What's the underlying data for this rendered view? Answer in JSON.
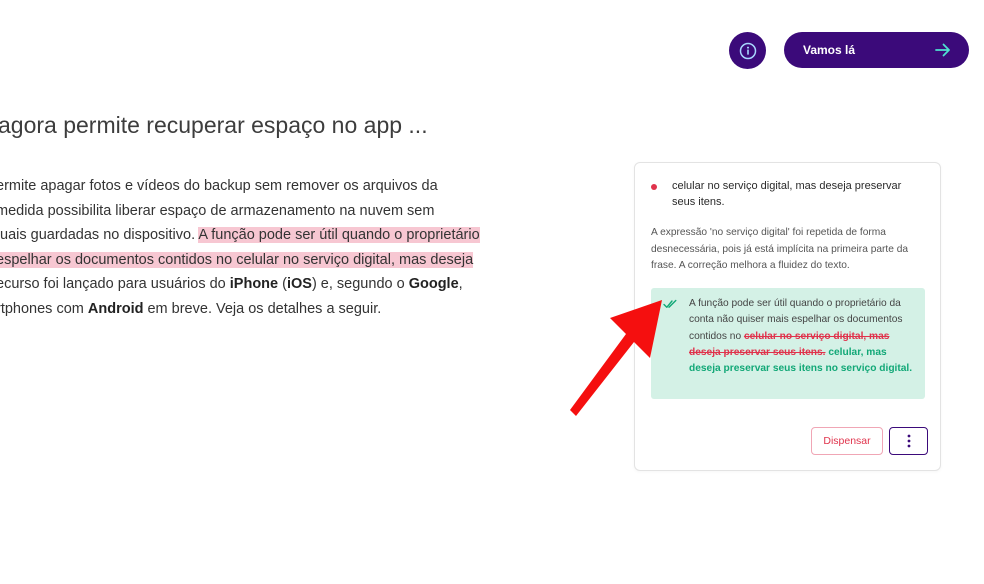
{
  "header": {
    "info_icon": "info-circle-icon",
    "cta_label": "Vamos lá",
    "cta_icon": "arrow-right-icon",
    "accent_color": "#3b0a7a"
  },
  "article": {
    "title": "agora permite recuperar espaço no app ...",
    "lines": {
      "l1": "ermite apagar fotos e vídeos do backup sem remover os arquivos da",
      "l2": "medida possibilita liberar espaço de armazenamento na nuvem sem",
      "l3_pre": "tuais guardadas no dispositivo. ",
      "l3_hl": "A função pode ser útil quando o proprietário",
      "l4_hl": " espelhar os documentos contidos no celular no serviço digital, mas deseja",
      "l5_a": "ecurso foi lançado para usuários do ",
      "l5_iphone": "iPhone",
      "l5_b": " (",
      "l5_ios": "iOS",
      "l5_c": ") e, segundo o ",
      "l5_google": "Google",
      "l5_d": ",",
      "l6_a": "rtphones com ",
      "l6_android": "Android",
      "l6_b": " em breve. Veja os detalhes a seguir."
    },
    "highlight_color": "#f7c7d2"
  },
  "card": {
    "issue_title": "celular no serviço digital, mas deseja preservar seus itens.",
    "explanation": "A expressão 'no serviço digital' foi repetida de forma desnecessária, pois já está implícita na primeira parte da frase. A correção melhora a fluidez do texto.",
    "suggestion": {
      "prefix": "A função pode ser útil quando o proprietário da conta não quiser mais espelhar os documentos contidos no ",
      "deleted": "celular no serviço digital, mas deseja preservar seus itens.",
      "inserted": "celular, mas deseja preservar seus itens no serviço digital."
    },
    "dismiss_label": "Dispensar",
    "more_icon": "more-vertical-icon",
    "check_icon": "double-check-icon",
    "deleted_color": "#e0334c",
    "inserted_color": "#12a877",
    "suggestion_bg": "#d4f1e6"
  },
  "annotation": {
    "arrow_icon": "red-arrow-icon",
    "arrow_color": "#f50f0f"
  }
}
